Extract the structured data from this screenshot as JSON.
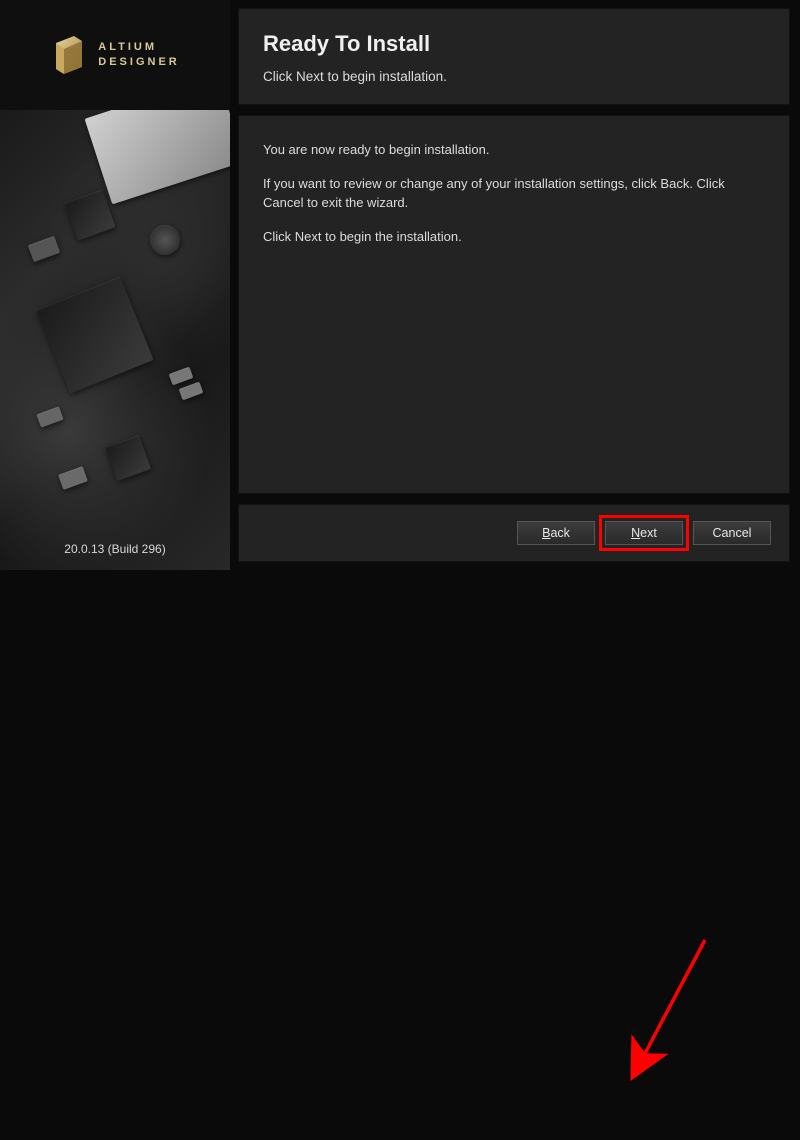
{
  "brand": {
    "line1": "ALTIUM",
    "line2": "DESIGNER"
  },
  "version": "20.0.13 (Build 296)",
  "header": {
    "title": "Ready To Install",
    "subtitle": "Click Next to begin installation."
  },
  "body": {
    "p1": "You are now ready to begin installation.",
    "p2": "If you want to review or change any of your installation settings, click Back. Click Cancel to exit the wizard.",
    "p3": "Click Next to begin the installation."
  },
  "buttons": {
    "back": "Back",
    "next": "Next",
    "cancel": "Cancel"
  },
  "annotation": {
    "highlight_target": "next-button",
    "color": "#ff0000"
  }
}
